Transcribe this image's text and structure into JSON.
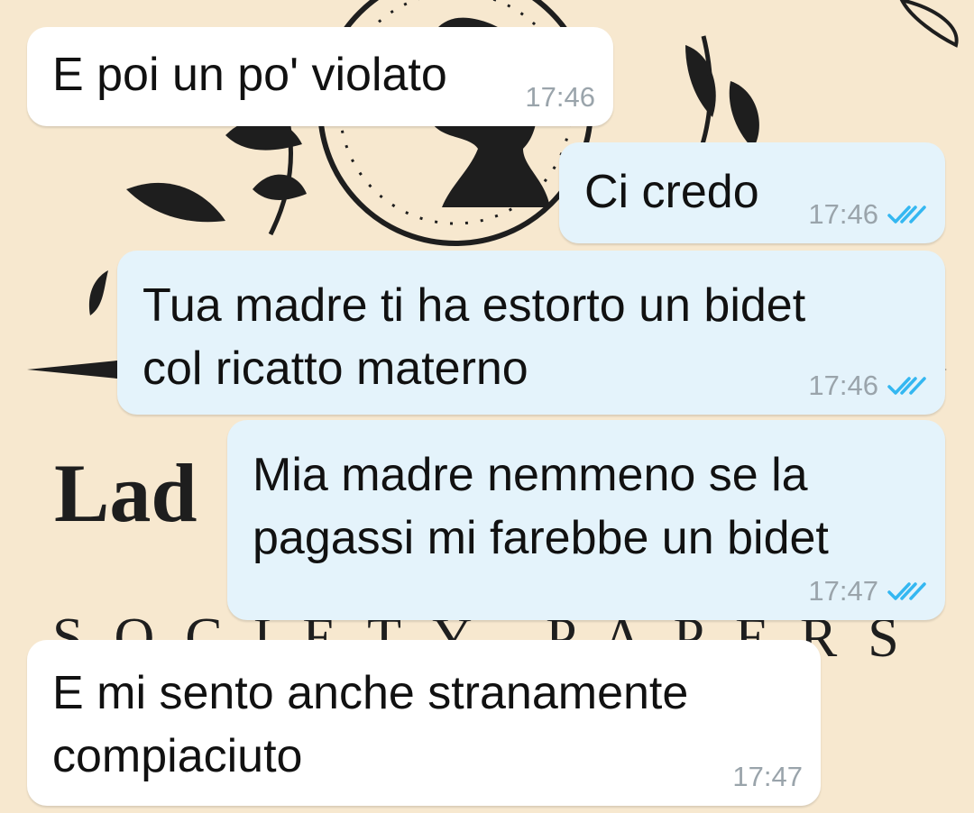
{
  "wallpaper": {
    "background_color": "#f7e8cf",
    "ink_color": "#1e1e1e",
    "fragments": {
      "brand_partial": "Lad",
      "subtitle_partial": "SOCIETY PAPERS"
    }
  },
  "colors": {
    "incoming_bubble": "#ffffff",
    "outgoing_bubble": "#e4f3fb",
    "timestamp": "#9aa4ab",
    "read_ticks": "#34b7f1"
  },
  "messages": [
    {
      "direction": "incoming",
      "lines": [
        "E poi un po' violato"
      ],
      "time": "17:46",
      "status": "none"
    },
    {
      "direction": "outgoing",
      "lines": [
        "Ci credo"
      ],
      "time": "17:46",
      "status": "read-double-check-icon"
    },
    {
      "direction": "outgoing",
      "lines": [
        "Tua madre ti ha estorto un bidet",
        "col ricatto materno"
      ],
      "time": "17:46",
      "status": "read-double-check-icon"
    },
    {
      "direction": "outgoing",
      "lines": [
        "Mia madre nemmeno se la",
        "pagassi mi farebbe un bidet"
      ],
      "time": "17:47",
      "status": "read-double-check-icon"
    },
    {
      "direction": "incoming",
      "lines": [
        "E mi sento anche stranamente",
        "compiaciuto"
      ],
      "time": "17:47",
      "status": "none"
    }
  ]
}
